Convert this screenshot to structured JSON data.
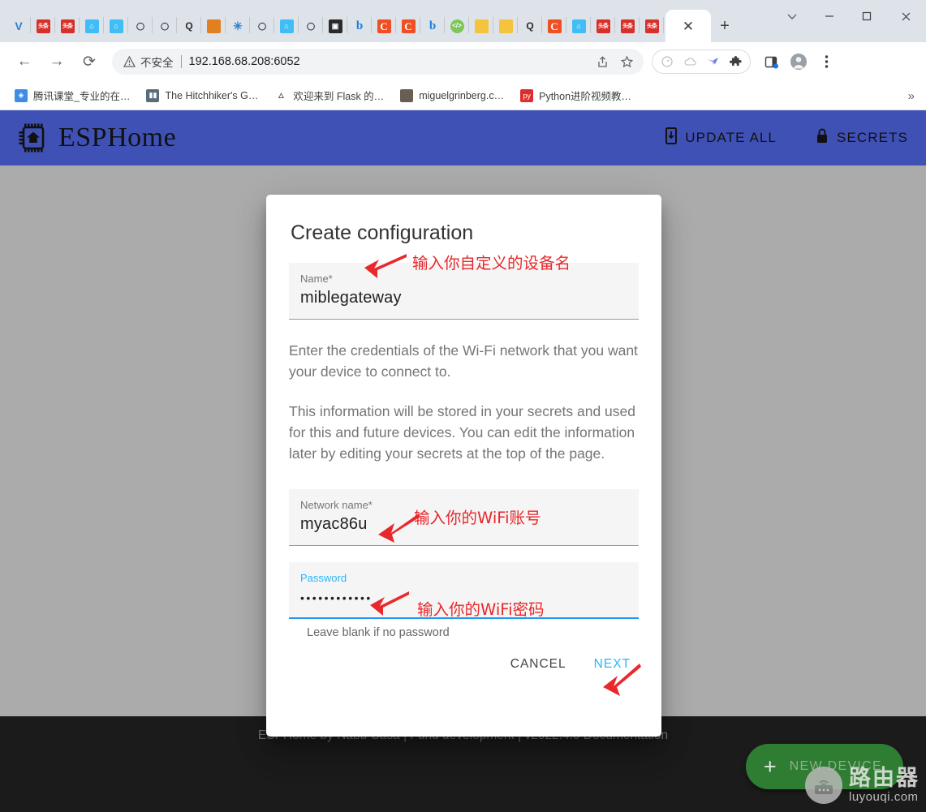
{
  "browser": {
    "window_controls": [
      "chevron-down",
      "minimize",
      "maximize",
      "close"
    ],
    "tabs_favicons": [
      {
        "name": "vivaldi-icon",
        "kind": "vivaldi",
        "text": "V"
      },
      {
        "name": "toutiao-icon",
        "kind": "toutiao",
        "text": "头条"
      },
      {
        "name": "toutiao-icon",
        "kind": "toutiao",
        "text": "头条"
      },
      {
        "name": "home-assistant-icon",
        "kind": "ha",
        "text": "⌂"
      },
      {
        "name": "home-assistant-icon",
        "kind": "ha",
        "text": "⌂"
      },
      {
        "name": "github-icon",
        "kind": "gh",
        "text": "◯"
      },
      {
        "name": "github-icon",
        "kind": "gh",
        "text": "◯"
      },
      {
        "name": "search-icon",
        "kind": "q",
        "text": "Q"
      },
      {
        "name": "thumbnail-icon",
        "kind": "orange",
        "text": ""
      },
      {
        "name": "bluetooth-icon",
        "kind": "bt",
        "text": "✳"
      },
      {
        "name": "github-icon",
        "kind": "gh",
        "text": "◯"
      },
      {
        "name": "home-assistant-icon",
        "kind": "ha",
        "text": "⌂"
      },
      {
        "name": "github-icon",
        "kind": "gh",
        "text": "◯"
      },
      {
        "name": "camera-icon",
        "kind": "cam",
        "text": "▣"
      },
      {
        "name": "bing-icon",
        "kind": "bing",
        "text": "b"
      },
      {
        "name": "csdn-icon",
        "kind": "c",
        "text": "C"
      },
      {
        "name": "csdn-icon",
        "kind": "c",
        "text": "C"
      },
      {
        "name": "bing-icon",
        "kind": "bing",
        "text": "b"
      },
      {
        "name": "code-icon",
        "kind": "code",
        "text": "</>"
      },
      {
        "name": "note-icon",
        "kind": "yellow",
        "text": ""
      },
      {
        "name": "note-icon",
        "kind": "yellow",
        "text": ""
      },
      {
        "name": "search-icon",
        "kind": "q",
        "text": "Q"
      },
      {
        "name": "csdn-icon",
        "kind": "c",
        "text": "C"
      },
      {
        "name": "home-assistant-icon",
        "kind": "ha",
        "text": "⌂"
      },
      {
        "name": "toutiao-icon",
        "kind": "toutiao",
        "text": "头条"
      },
      {
        "name": "toutiao-icon",
        "kind": "toutiao",
        "text": "头条"
      },
      {
        "name": "toutiao-icon",
        "kind": "toutiao",
        "text": "头条"
      }
    ],
    "active_tab_close": "✕",
    "new_tab": "+",
    "nav": {
      "back": "←",
      "forward": "→",
      "reload": "⟳"
    },
    "omnibox": {
      "security_label": "不安全",
      "url": "192.168.68.208:6052",
      "share_icon": "share-icon",
      "bookmark_icon": "star-icon"
    },
    "extensions": [
      "speed-icon",
      "cloud-icon",
      "bird-icon",
      "puzzle-icon"
    ],
    "toolbar_icons": [
      "sidepanel-icon",
      "profile-avatar",
      "more-menu-icon"
    ],
    "bookmarks": [
      {
        "label": "腾讯课堂_专业的在…",
        "icon": "tencent-icon",
        "color": "#3f8ce8",
        "glyph": "◈"
      },
      {
        "label": "The Hitchhiker's G…",
        "icon": "book-icon",
        "color": "#5a6b7a",
        "glyph": "▮▮"
      },
      {
        "label": "欢迎来到 Flask 的…",
        "icon": "flask-icon",
        "color": "#ffffff",
        "glyph": "🜂"
      },
      {
        "label": "miguelgrinberg.c…",
        "icon": "portrait-icon",
        "color": "#6a5d52",
        "glyph": ""
      },
      {
        "label": "Python进阶视频教…",
        "icon": "pypi-icon",
        "color": "#e02c2c",
        "glyph": "py"
      }
    ],
    "bookmarks_overflow": "»"
  },
  "app": {
    "brand": "ESPHome",
    "logo_icon": "esphome-chip-house-icon",
    "actions": [
      {
        "label": "UPDATE ALL",
        "icon": "update-icon",
        "name": "update-all-button"
      },
      {
        "label": "SECRETS",
        "icon": "lock-icon",
        "name": "secrets-button"
      }
    ],
    "footer": "ESPHome by Nabu Casa | Fund development | v2022.4.0 Documentation",
    "fab": {
      "label": "NEW DEVICE",
      "icon": "plus-icon"
    },
    "watermark": {
      "cn": "路由器",
      "en": "luyouqi.com",
      "icon": "router-icon"
    }
  },
  "dialog": {
    "title": "Create configuration",
    "name_field": {
      "label": "Name*",
      "value": "miblegateway"
    },
    "paragraph1": "Enter the credentials of the Wi-Fi network that you want your device to connect to.",
    "paragraph2": "This information will be stored in your secrets and used for this and future devices. You can edit the information later by editing your secrets at the top of the page.",
    "network_field": {
      "label": "Network name*",
      "value": "myac86u"
    },
    "password_field": {
      "label": "Password",
      "value": "••••••••••••",
      "helper": "Leave blank if no password"
    },
    "cancel_label": "CANCEL",
    "next_label": "NEXT"
  },
  "annotations": [
    {
      "text": "输入你自定义的设备名",
      "name": "annotation-device-name"
    },
    {
      "text": "输入你的WiFi账号",
      "name": "annotation-wifi-ssid"
    },
    {
      "text": "输入你的WiFi密码",
      "name": "annotation-wifi-password"
    }
  ],
  "colors": {
    "annotation_red": "#e8282b",
    "accent_blue": "#29b6f6",
    "fab_green": "#2e7d32",
    "scrim_gray": "#ababab",
    "footer_dark": "#1b1b1b"
  }
}
